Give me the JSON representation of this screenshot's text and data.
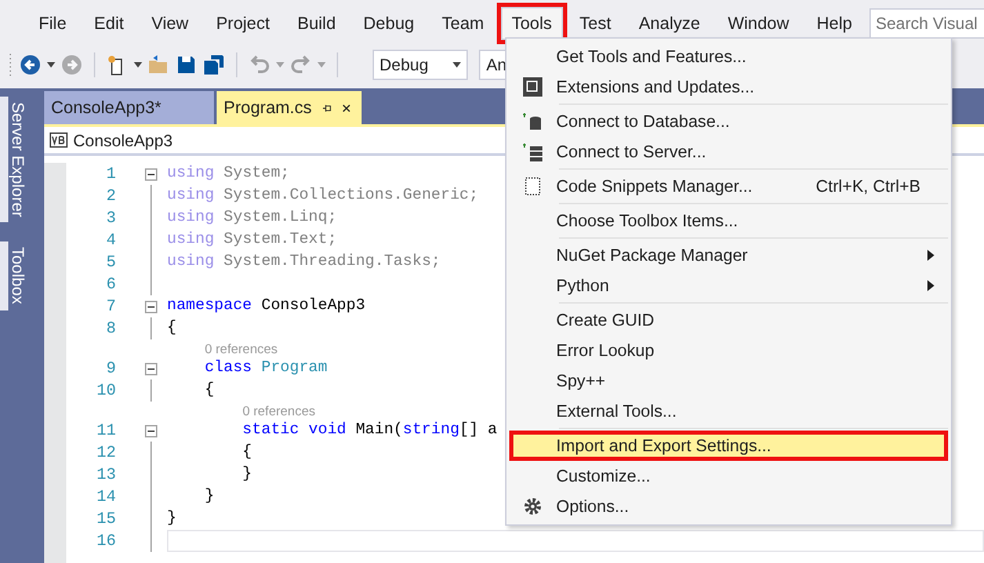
{
  "menu_bar": {
    "items": [
      {
        "label": "File",
        "selected": false,
        "annotated": false
      },
      {
        "label": "Edit",
        "selected": false,
        "annotated": false
      },
      {
        "label": "View",
        "selected": false,
        "annotated": false
      },
      {
        "label": "Project",
        "selected": false,
        "annotated": false
      },
      {
        "label": "Build",
        "selected": false,
        "annotated": false
      },
      {
        "label": "Debug",
        "selected": false,
        "annotated": false
      },
      {
        "label": "Team",
        "selected": false,
        "annotated": false
      },
      {
        "label": "Tools",
        "selected": true,
        "annotated": true
      },
      {
        "label": "Test",
        "selected": false,
        "annotated": false
      },
      {
        "label": "Analyze",
        "selected": false,
        "annotated": false
      },
      {
        "label": "Window",
        "selected": false,
        "annotated": false
      },
      {
        "label": "Help",
        "selected": false,
        "annotated": false
      }
    ],
    "search": {
      "placeholder": "Search Visual"
    }
  },
  "toolbar": {
    "items": [
      {
        "kind": "back",
        "disabled": false
      },
      {
        "kind": "caret",
        "disabled": false
      },
      {
        "kind": "forward",
        "disabled": true
      },
      {
        "kind": "sep"
      },
      {
        "kind": "new",
        "disabled": false
      },
      {
        "kind": "caret",
        "disabled": false
      },
      {
        "kind": "open",
        "disabled": false
      },
      {
        "kind": "save",
        "disabled": false
      },
      {
        "kind": "save-all",
        "disabled": false
      },
      {
        "kind": "sep"
      },
      {
        "kind": "undo",
        "disabled": true
      },
      {
        "kind": "caret",
        "disabled": true
      },
      {
        "kind": "redo",
        "disabled": true
      },
      {
        "kind": "caret",
        "disabled": true
      },
      {
        "kind": "sep"
      }
    ],
    "combos": [
      {
        "value": "Debug",
        "caret": true
      },
      {
        "value": "An",
        "caret": false
      }
    ]
  },
  "side_tabs": [
    {
      "label": "Server Explorer"
    },
    {
      "label": "Toolbox"
    }
  ],
  "tabs": [
    {
      "label": "ConsoleApp3*",
      "selected": false
    },
    {
      "label": "Program.cs",
      "selected": true
    }
  ],
  "nav_bar": {
    "project": "ConsoleApp3"
  },
  "code": {
    "lines": [
      {
        "kind": "code",
        "number": "1",
        "fold": true,
        "current": false,
        "tokens": [
          {
            "text": "using",
            "kind": "faded-keyword"
          },
          {
            "text": " System;",
            "kind": "faded"
          }
        ]
      },
      {
        "kind": "code",
        "number": "2",
        "fold": false,
        "current": false,
        "tokens": [
          {
            "text": "using",
            "kind": "faded-keyword"
          },
          {
            "text": " System.Collections.Generic;",
            "kind": "faded"
          }
        ]
      },
      {
        "kind": "code",
        "number": "3",
        "fold": false,
        "current": false,
        "tokens": [
          {
            "text": "using",
            "kind": "faded-keyword"
          },
          {
            "text": " System.Linq;",
            "kind": "faded"
          }
        ]
      },
      {
        "kind": "code",
        "number": "4",
        "fold": false,
        "current": false,
        "tokens": [
          {
            "text": "using",
            "kind": "faded-keyword"
          },
          {
            "text": " System.Text;",
            "kind": "faded"
          }
        ]
      },
      {
        "kind": "code",
        "number": "5",
        "fold": false,
        "current": false,
        "tokens": [
          {
            "text": "using",
            "kind": "faded-keyword"
          },
          {
            "text": " System.Threading.Tasks;",
            "kind": "faded"
          }
        ]
      },
      {
        "kind": "code",
        "number": "6",
        "fold": false,
        "current": false
      },
      {
        "kind": "code",
        "number": "7",
        "fold": true,
        "current": false,
        "tokens": [
          {
            "text": "namespace",
            "kind": "keyword"
          },
          {
            "text": " ConsoleApp3",
            "kind": "plain"
          }
        ]
      },
      {
        "kind": "code",
        "number": "8",
        "fold": false,
        "current": false,
        "tokens": [
          {
            "text": "{",
            "kind": "plain"
          }
        ]
      },
      {
        "kind": "codelens",
        "text": "0 references"
      },
      {
        "kind": "code",
        "number": "9",
        "fold": true,
        "current": false,
        "tokens": [
          {
            "text": "    class",
            "kind": "keyword"
          },
          {
            "text": " Program",
            "kind": "type"
          }
        ]
      },
      {
        "kind": "code",
        "number": "10",
        "fold": false,
        "current": false,
        "tokens": [
          {
            "text": "    {",
            "kind": "plain"
          }
        ]
      },
      {
        "kind": "codelens",
        "text": "0 references"
      },
      {
        "kind": "code",
        "number": "11",
        "fold": true,
        "current": false,
        "tokens": [
          {
            "text": "        static void",
            "kind": "keyword"
          },
          {
            "text": " Main(",
            "kind": "plain"
          },
          {
            "text": "string",
            "kind": "keyword"
          },
          {
            "text": "[] a",
            "kind": "plain"
          }
        ]
      },
      {
        "kind": "code",
        "number": "12",
        "fold": false,
        "current": false,
        "tokens": [
          {
            "text": "        {",
            "kind": "plain"
          }
        ]
      },
      {
        "kind": "code",
        "number": "13",
        "fold": false,
        "current": false,
        "tokens": [
          {
            "text": "        }",
            "kind": "plain"
          }
        ]
      },
      {
        "kind": "code",
        "number": "14",
        "fold": false,
        "current": false,
        "tokens": [
          {
            "text": "    }",
            "kind": "plain"
          }
        ]
      },
      {
        "kind": "code",
        "number": "15",
        "fold": false,
        "current": false,
        "tokens": [
          {
            "text": "}",
            "kind": "plain"
          }
        ]
      },
      {
        "kind": "code",
        "number": "16",
        "fold": false,
        "current": true
      }
    ]
  },
  "tools_menu": {
    "groups": [
      [
        {
          "label": "Get Tools and Features...",
          "kind": "plain",
          "submenu": false,
          "selected": false,
          "annotated": false
        },
        {
          "label": "Extensions and Updates...",
          "kind": "extensions",
          "submenu": false,
          "selected": false,
          "annotated": false
        }
      ],
      [
        {
          "label": "Connect to Database...",
          "kind": "database",
          "submenu": false,
          "selected": false,
          "annotated": false
        },
        {
          "label": "Connect to Server...",
          "kind": "server",
          "submenu": false,
          "selected": false,
          "annotated": false
        }
      ],
      [
        {
          "label": "Code Snippets Manager...",
          "kind": "snippet",
          "shortcut": "Ctrl+K, Ctrl+B",
          "submenu": false,
          "selected": false,
          "annotated": false
        }
      ],
      [
        {
          "label": "Choose Toolbox Items...",
          "kind": "plain",
          "submenu": false,
          "selected": false,
          "annotated": false
        }
      ],
      [
        {
          "label": "NuGet Package Manager",
          "kind": "plain",
          "submenu": true,
          "selected": false,
          "annotated": false
        },
        {
          "label": "Python",
          "kind": "plain",
          "submenu": true,
          "selected": false,
          "annotated": false
        }
      ],
      [
        {
          "label": "Create GUID",
          "kind": "plain",
          "submenu": false,
          "selected": false,
          "annotated": false
        },
        {
          "label": "Error Lookup",
          "kind": "plain",
          "submenu": false,
          "selected": false,
          "annotated": false
        },
        {
          "label": "Spy++",
          "kind": "plain",
          "submenu": false,
          "selected": false,
          "annotated": false
        },
        {
          "label": "External Tools...",
          "kind": "plain",
          "submenu": false,
          "selected": false,
          "annotated": false
        }
      ],
      [
        {
          "label": "Import and Export Settings...",
          "kind": "plain",
          "submenu": false,
          "selected": true,
          "annotated": true
        },
        {
          "label": "Customize...",
          "kind": "plain",
          "submenu": false,
          "selected": false,
          "annotated": false
        },
        {
          "label": "Options...",
          "kind": "gear",
          "submenu": false,
          "selected": false,
          "annotated": false
        }
      ]
    ]
  }
}
